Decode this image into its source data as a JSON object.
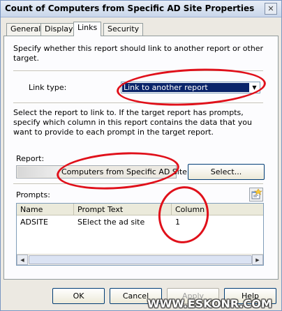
{
  "window": {
    "title": "Count of Computers from Specific AD Site Properties",
    "close_glyph": "✕"
  },
  "tabs": [
    {
      "label": "General"
    },
    {
      "label": "Display"
    },
    {
      "label": "Links",
      "active": true
    },
    {
      "label": "Security"
    }
  ],
  "links": {
    "intro": "Specify whether this report should link to another report or other target.",
    "link_type_label": "Link type:",
    "link_type_value": "Link to another report",
    "description": "Select the report to link to. If the target report has prompts, specify which column in this report contains the data that you want to provide to each prompt in the target report.",
    "report_label": "Report:",
    "report_value": "Computers from Specific AD Site",
    "select_button": "Select...",
    "prompts_label": "Prompts:"
  },
  "prompts_table": {
    "columns": [
      "Name",
      "Prompt Text",
      "Column"
    ],
    "rows": [
      [
        "ADSITE",
        "SElect the ad site",
        "1"
      ]
    ]
  },
  "footer": {
    "ok": "OK",
    "cancel": "Cancel",
    "apply": "Apply",
    "help": "Help"
  },
  "watermark": "WWW.ESKONR.COM",
  "colors": {
    "highlight": "#0a246a",
    "annotation_red": "#e0101a"
  }
}
